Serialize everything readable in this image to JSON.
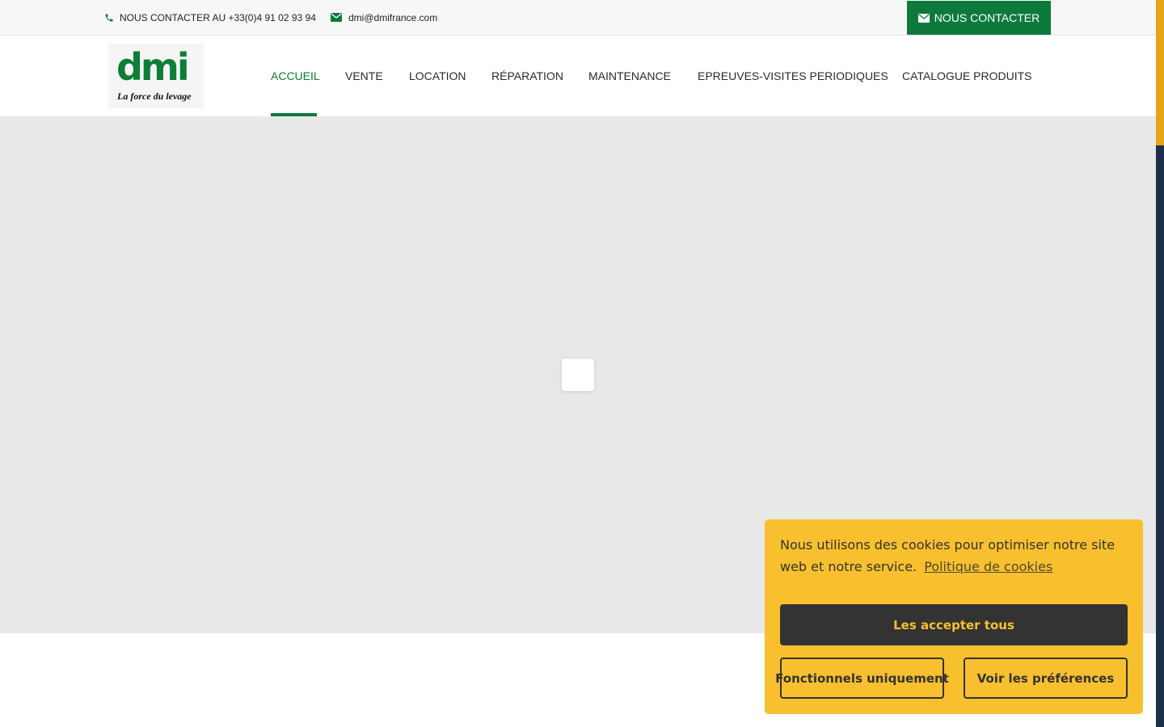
{
  "topbar": {
    "phone_text": "NOUS CONTACTER AU +33(0)4 91 02 93 94",
    "email_text": "dmi@dmifrance.com",
    "contact_button": "NOUS CONTACTER"
  },
  "logo": {
    "letters": "dmi",
    "tagline": "La force du levage"
  },
  "nav": {
    "items": [
      {
        "label": "ACCUEIL",
        "active": true
      },
      {
        "label": "VENTE"
      },
      {
        "label": "LOCATION"
      },
      {
        "label": "RÉPARATION"
      },
      {
        "label": "MAINTENANCE"
      },
      {
        "label": "EPREUVES-VISITES PERIODIQUES"
      },
      {
        "label": "CATALOGUE PRODUITS"
      }
    ]
  },
  "cookie": {
    "message": "Nous utilisons des cookies pour optimiser notre site web et notre service.",
    "policy_link": "Politique de cookies",
    "accept_all": "Les accepter tous",
    "functional_only": "Fonctionnels uniquement",
    "view_preferences": "Voir les préférences"
  },
  "colors": {
    "brand_green": "#0d7a3c",
    "cookie_yellow": "#f8c02e",
    "dark": "#333333",
    "scroll_thumb": "#e8a317",
    "scroll_track": "#1c3148"
  },
  "icons": {
    "phone": "phone-icon",
    "email": "envelope-icon"
  }
}
